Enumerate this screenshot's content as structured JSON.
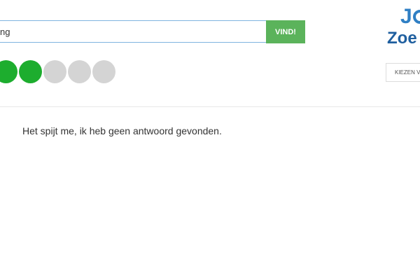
{
  "search": {
    "value": "ng",
    "button_label": "VIND!"
  },
  "rating": {
    "filled": 2,
    "total": 5,
    "filled_color": "#1dad2e",
    "empty_color": "#d4d4d4"
  },
  "result": {
    "message": "Het spijt me, ik heb geen antwoord gevonden."
  },
  "logo": {
    "line1": "J",
    "line2": "Zoe",
    "color": "#2f7fc4"
  },
  "header": {
    "choose_label": "KIEZEN V"
  }
}
